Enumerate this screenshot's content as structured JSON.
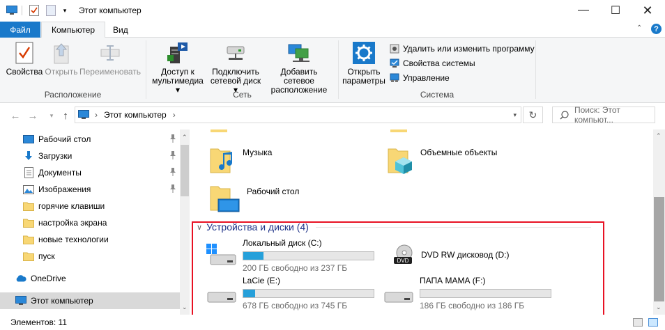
{
  "window": {
    "title": "Этот компьютер"
  },
  "tabs": {
    "file": "Файл",
    "computer": "Компьютер",
    "view": "Вид"
  },
  "ribbon": {
    "location": {
      "label": "Расположение",
      "properties": "Свойства",
      "open": "Открыть",
      "rename": "Переименовать"
    },
    "network": {
      "label": "Сеть",
      "media_access": [
        "Доступ к",
        "мультимедиа ▾"
      ],
      "map_drive": [
        "Подключить",
        "сетевой диск ▾"
      ],
      "add_location": [
        "Добавить сетевое",
        "расположение"
      ]
    },
    "system": {
      "label": "Система",
      "open_settings": [
        "Открыть",
        "параметры"
      ],
      "uninstall": "Удалить или изменить программу",
      "system_props": "Свойства системы",
      "manage": "Управление"
    }
  },
  "address": {
    "path": "Этот компьютер",
    "search_placeholder": "Поиск: Этот компьют..."
  },
  "nav": {
    "items": [
      {
        "label": "Рабочий стол",
        "icon": "desktop-icon",
        "pinned": true
      },
      {
        "label": "Загрузки",
        "icon": "download-icon",
        "pinned": true
      },
      {
        "label": "Документы",
        "icon": "document-icon",
        "pinned": true
      },
      {
        "label": "Изображения",
        "icon": "pictures-icon",
        "pinned": true
      },
      {
        "label": "горячие клавиши",
        "icon": "folder-icon",
        "pinned": false
      },
      {
        "label": "настройка экрана",
        "icon": "folder-icon",
        "pinned": false
      },
      {
        "label": "новые технологии",
        "icon": "folder-icon",
        "pinned": false
      },
      {
        "label": "пуск",
        "icon": "folder-icon",
        "pinned": false
      }
    ],
    "onedrive": "OneDrive",
    "this_pc": "Этот компьютер"
  },
  "folders": [
    {
      "name": "Музыка",
      "icon": "music-folder-icon"
    },
    {
      "name": "Объемные объекты",
      "icon": "3d-objects-folder-icon"
    },
    {
      "name": "Рабочий стол",
      "icon": "desktop-folder-icon"
    }
  ],
  "devices": {
    "header": "Устройства и диски (4)",
    "drives": [
      {
        "name": "Локальный диск (C:)",
        "free": "200 ГБ свободно из 237 ГБ",
        "used_fraction": 0.156,
        "icon": "windows-drive-icon"
      },
      {
        "name": "DVD RW дисковод (D:)",
        "free": "",
        "used_fraction": null,
        "icon": "dvd-drive-icon"
      },
      {
        "name": "LaCie (E:)",
        "free": "678 ГБ свободно из 745 ГБ",
        "used_fraction": 0.09,
        "icon": "hdd-icon"
      },
      {
        "name": "ПАПА МАМА (F:)",
        "free": "186 ГБ свободно из 186 ГБ",
        "used_fraction": 0.0,
        "icon": "hdd-icon"
      }
    ]
  },
  "status": {
    "items": "Элементов: 11"
  },
  "colors": {
    "accent": "#1979ca",
    "progress": "#26a0da",
    "highlight": "#e81123",
    "group_header": "#1e3287"
  }
}
